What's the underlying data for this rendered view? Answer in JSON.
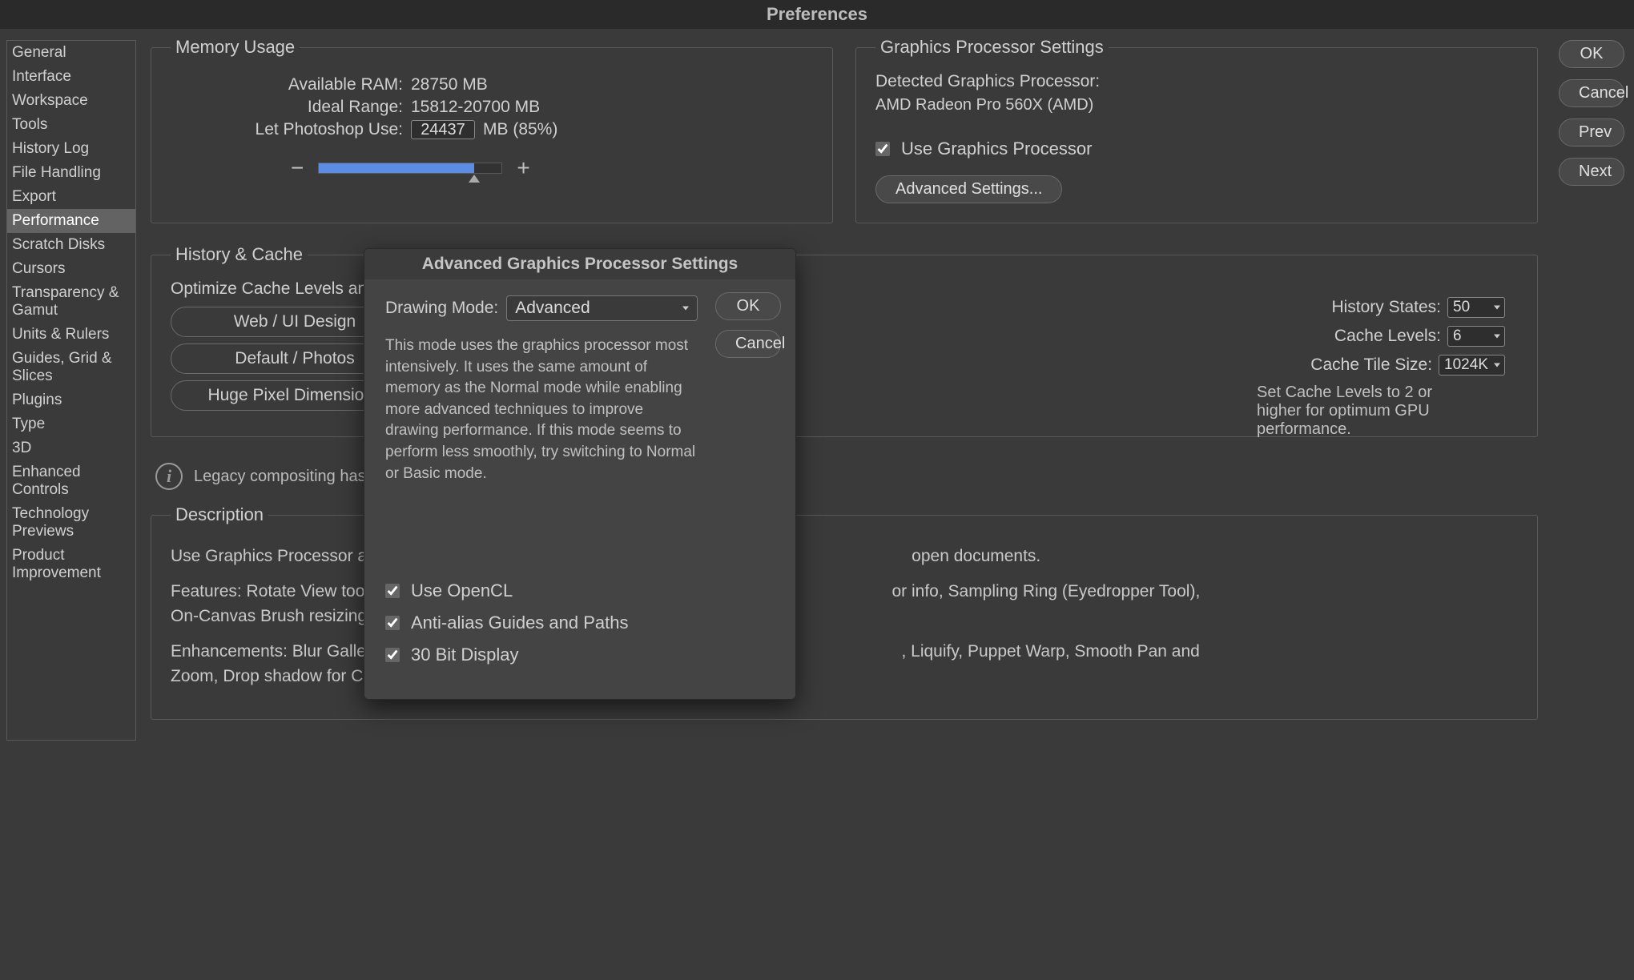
{
  "window": {
    "title": "Preferences"
  },
  "sidebar": {
    "items": [
      "General",
      "Interface",
      "Workspace",
      "Tools",
      "History Log",
      "File Handling",
      "Export",
      "Performance",
      "Scratch Disks",
      "Cursors",
      "Transparency & Gamut",
      "Units & Rulers",
      "Guides, Grid & Slices",
      "Plugins",
      "Type",
      "3D",
      "Enhanced Controls",
      "Technology Previews",
      "Product Improvement"
    ],
    "selected_index": 7
  },
  "memory": {
    "legend": "Memory Usage",
    "available_label": "Available RAM:",
    "available_value": "28750 MB",
    "ideal_label": "Ideal Range:",
    "ideal_value": "15812-20700 MB",
    "use_label": "Let Photoshop Use:",
    "use_value": "24437",
    "use_suffix": "MB (85%)"
  },
  "gpu": {
    "legend": "Graphics Processor Settings",
    "detected_label": "Detected Graphics Processor:",
    "detected_value": "AMD Radeon Pro 560X (AMD)",
    "use_gpu_label": "Use Graphics Processor",
    "advanced_button": "Advanced Settings..."
  },
  "history_cache": {
    "legend": "History & Cache",
    "optimize_label": "Optimize Cache Levels and Tile Size for:",
    "buttons": [
      "Web / UI Design",
      "Default / Photos",
      "Huge Pixel Dimensions"
    ],
    "history_states_label": "History States:",
    "history_states_value": "50",
    "cache_levels_label": "Cache Levels:",
    "cache_levels_value": "6",
    "cache_tile_label": "Cache Tile Size:",
    "cache_tile_value": "1024K",
    "hint": "Set Cache Levels to 2 or higher for optimum GPU performance."
  },
  "legacy_note": "Legacy compositing has been re",
  "description": {
    "legend": "Description",
    "p1_prefix": "Use Graphics Processor activates certai",
    "p1_suffix": "open documents.",
    "p2_prefix": "Features: Rotate View tool, Birds-eye z",
    "p2_mid": "or info, Sampling Ring (Eyedropper Tool),",
    "p2_line2": "On-Canvas Brush resizing, Bristle Tip P",
    "p3_prefix": "Enhancements: Blur Gallery, Smart Sha",
    "p3_mid": ", Liquify, Puppet Warp, Smooth Pan and",
    "p3_line2": "Zoom, Drop shadow for Canvas Border,"
  },
  "buttons": {
    "ok": "OK",
    "cancel": "Cancel",
    "prev": "Prev",
    "next": "Next"
  },
  "modal": {
    "title": "Advanced Graphics Processor Settings",
    "drawing_mode_label": "Drawing Mode:",
    "drawing_mode_value": "Advanced",
    "description": "This mode uses the graphics processor most intensively. It uses the same amount of memory as the Normal mode while enabling more advanced techniques to improve drawing performance.  If this mode seems to perform less smoothly, try switching to Normal or Basic mode.",
    "use_opencl": "Use OpenCL",
    "anti_alias": "Anti-alias Guides and Paths",
    "thirty_bit": "30 Bit Display",
    "ok": "OK",
    "cancel": "Cancel"
  }
}
